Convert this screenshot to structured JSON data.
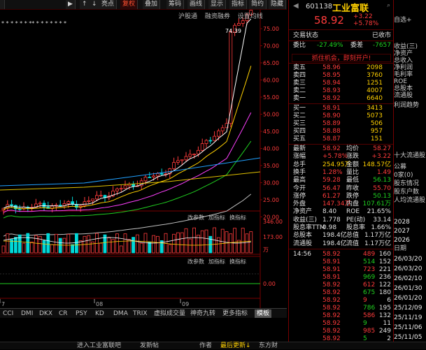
{
  "toolbar": {
    "items": [
      "",
      "▶",
      "↑",
      "↓",
      "亮点",
      "复权",
      "叠加",
      "筹码",
      "画线",
      "显示",
      "指标",
      "简约",
      "隐藏"
    ],
    "active_index": 5
  },
  "indicator_row": {
    "labels": [
      "沪股通",
      "融资融券",
      "设置均线"
    ]
  },
  "chart": {
    "star_marks": "*  *  *   *  *  *   **   *  *   *  *  *   *  *",
    "price_axis": [
      "75.00",
      "70.00",
      "65.00",
      "60.00",
      "55.00",
      "50.00",
      "45.00",
      "40.00",
      "35.00",
      "30.00",
      "25.00",
      "20.00"
    ],
    "high_label": "74.39",
    "vol_axis": [
      "346.00",
      "173.00"
    ],
    "vol_unit": "万",
    "vol_panel_labels": [
      "改参数",
      "加指标",
      "换指标"
    ],
    "sub_panel_labels": [
      "改参数",
      "加指标",
      "换指标"
    ],
    "month_labels": [
      "7",
      "08",
      "09"
    ],
    "sub_axis": [
      "0.00"
    ]
  },
  "bottom_tabs": {
    "items": [
      "CCI",
      "DMI",
      "DKX",
      "CR",
      "PSY",
      "KD",
      "DMA",
      "TRIX",
      "虚拟成交量",
      "神奇九转",
      "更多指标",
      "模板"
    ],
    "active_index": 11
  },
  "status": {
    "left": "进入工业富联吧",
    "mid": "发新帖",
    "right": [
      "作者",
      "最后更新↓",
      "东方财"
    ]
  },
  "stock": {
    "code": "601138",
    "name": "工业富联",
    "price": "58.92",
    "change": "+3.22",
    "change_pct": "+5.78%"
  },
  "trade_status": {
    "label": "交易状态",
    "value": "已收市"
  },
  "ratio": {
    "k1": "委比",
    "v1": "-27.49%",
    "k2": "委差",
    "v2": "-7657"
  },
  "ad_text": "抓住机会，即刻开户!",
  "sell_orders": [
    [
      "卖五",
      "58.96",
      "2098"
    ],
    [
      "卖四",
      "58.95",
      "3760"
    ],
    [
      "卖三",
      "58.94",
      "1251"
    ],
    [
      "卖二",
      "58.93",
      "4007"
    ],
    [
      "卖一",
      "58.92",
      "6640"
    ]
  ],
  "buy_orders": [
    [
      "买一",
      "58.91",
      "3413"
    ],
    [
      "买二",
      "58.90",
      "5073"
    ],
    [
      "买三",
      "58.89",
      "506"
    ],
    [
      "买四",
      "58.88",
      "957"
    ],
    [
      "买五",
      "58.87",
      "151"
    ]
  ],
  "stats": [
    [
      "最新",
      "58.92",
      "均价",
      "58.27"
    ],
    [
      "涨幅",
      "+5.78%",
      "涨跌",
      "+3.22"
    ],
    [
      "总手",
      "254.95万",
      "金额",
      "148.57亿"
    ],
    [
      "换手",
      "1.28%",
      "量比",
      "1.49"
    ],
    [
      "最高",
      "59.28",
      "最低",
      "56.13"
    ],
    [
      "今开",
      "56.47",
      "昨收",
      "55.70"
    ],
    [
      "涨停",
      "61.27",
      "跌停",
      "50.13"
    ],
    [
      "外盘",
      "147.34万",
      "内盘",
      "107.61万"
    ],
    [
      "净资产",
      "8.40",
      "ROE",
      "21.65%"
    ],
    [
      "收益(三)",
      "1.778",
      "PE(动)",
      "33.14"
    ],
    [
      "股息率TTM",
      "0.98",
      "股息率",
      "1.66%"
    ],
    [
      "总股本",
      "198.4亿",
      "总值",
      "1.17万亿"
    ],
    [
      "流通股",
      "198.4亿",
      "流值",
      "1.17万亿"
    ]
  ],
  "ticks": [
    [
      "14:56",
      "58.92",
      "489",
      "160"
    ],
    [
      "",
      "58.91",
      "514",
      "152"
    ],
    [
      "",
      "58.91",
      "723",
      "221"
    ],
    [
      "",
      "58.91",
      "969",
      "236"
    ],
    [
      "",
      "58.92",
      "612",
      "122"
    ],
    [
      "",
      "58.92",
      "675",
      "180"
    ],
    [
      "",
      "58.92",
      "9",
      "6"
    ],
    [
      "",
      "58.92",
      "786",
      "195"
    ],
    [
      "",
      "58.92",
      "586",
      "132"
    ],
    [
      "",
      "58.92",
      "9",
      "11"
    ],
    [
      "",
      "58.92",
      "985",
      "249"
    ],
    [
      "",
      "58.92",
      "5",
      "2"
    ]
  ],
  "far_panel": {
    "top": [
      "自选+",
      "收益(三)",
      "净资产",
      "总收入",
      "净利润",
      "毛利率",
      "ROE",
      "总股本",
      "流通股"
    ],
    "sub_title": "利润趋势",
    "top10": "十大流通股东",
    "holders": [
      "公募",
      "0家(0)",
      "股东情况",
      "股东户数",
      "人均流通股"
    ],
    "years": [
      "2028",
      "2027",
      "2026"
    ],
    "date_header": "日期",
    "dates": [
      "26/03/20",
      "26/03/20",
      "26/02/10",
      "26/01/30",
      "26/01/20",
      "25/12/09",
      "25/11/19",
      "25/11/06",
      "25/11/05"
    ]
  }
}
